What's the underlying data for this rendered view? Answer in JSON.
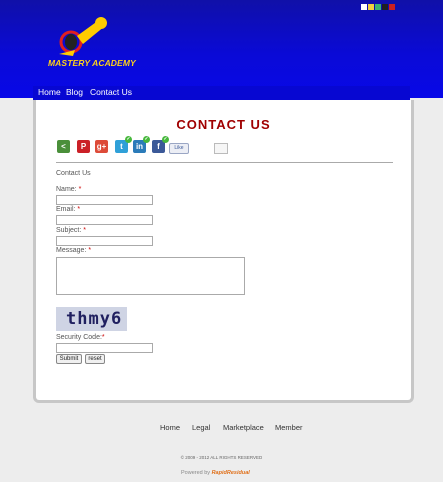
{
  "header": {
    "logo_text": "MASTERY ACADEMY",
    "swatches": [
      "#ffffff",
      "#f0d040",
      "#3cb371",
      "#202020",
      "#cc2020"
    ]
  },
  "nav": {
    "items": [
      {
        "label": "Home"
      },
      {
        "label": "Blog"
      },
      {
        "label": "Contact Us"
      }
    ]
  },
  "page": {
    "title": "CONTACT US",
    "social_icons": [
      "share-icon",
      "pinterest-icon",
      "google-plus-icon",
      "twitter-icon",
      "linkedin-icon",
      "facebook-icon",
      "facebook-like-icon",
      "email-icon"
    ],
    "fb_like_label": "Like",
    "form": {
      "heading": "Contact Us",
      "name_label": "Name:",
      "email_label": "Email:",
      "subject_label": "Subject:",
      "message_label": "Message:",
      "required_mark": "*",
      "captcha_text": "thmy6",
      "security_label": "Security Code:",
      "submit_label": "Submit",
      "reset_label": "reset"
    }
  },
  "footer": {
    "links": [
      {
        "label": "Home"
      },
      {
        "label": "Legal"
      },
      {
        "label": "Marketplace"
      },
      {
        "label": "Member"
      }
    ],
    "copyright": "© 2009 - 2012 ALL RIGHTS RESERVED",
    "powered_by": "Powered by",
    "powered_brand": "RapidResidual"
  },
  "colors": {
    "header": "#0a0ad6",
    "title": "#a00000",
    "nav": "#0707d2"
  }
}
